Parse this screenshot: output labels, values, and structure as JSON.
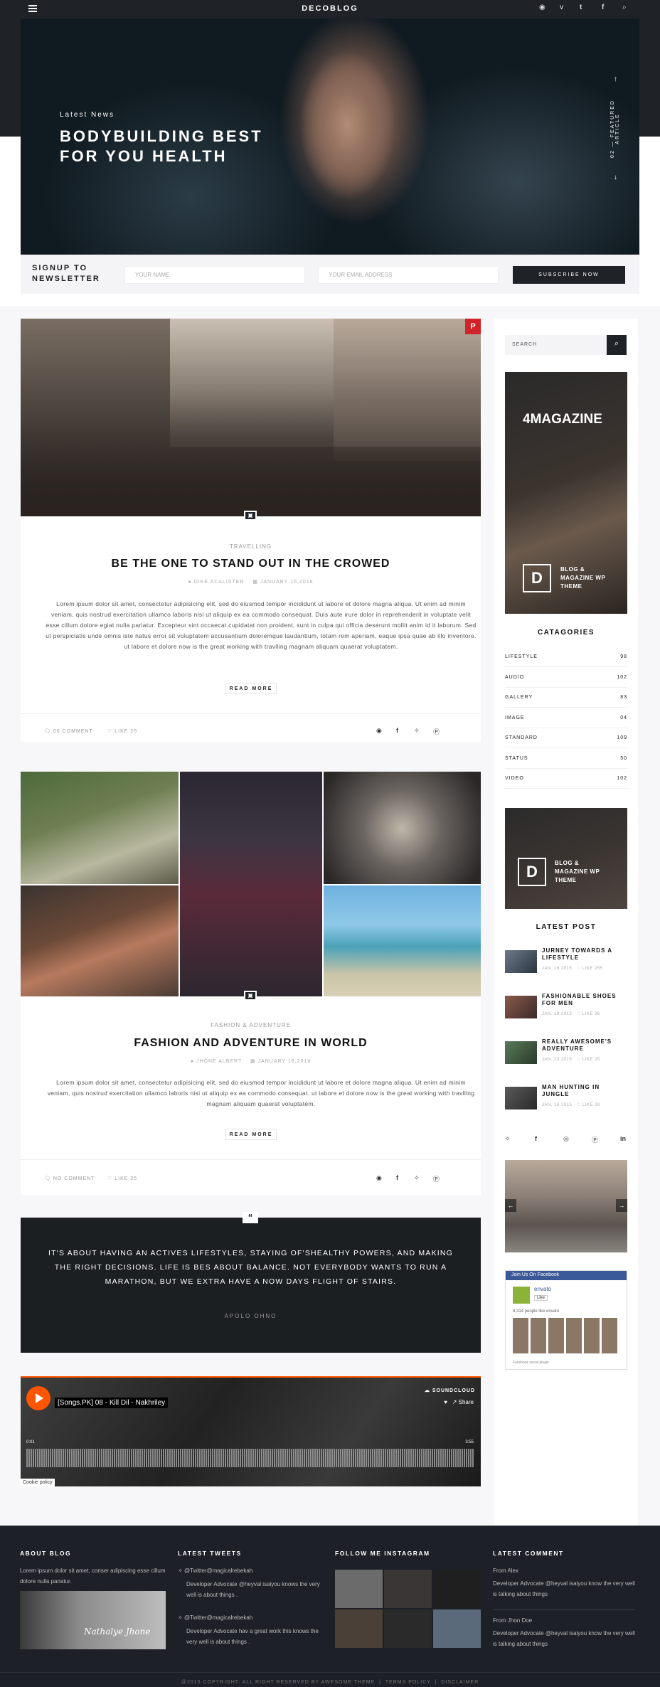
{
  "topbar": {
    "logo": "DECOBLOG",
    "social": [
      "rss-icon",
      "vimeo-icon",
      "tumblr-icon",
      "facebook-icon",
      "search-icon"
    ]
  },
  "hero": {
    "kicker": "Latest News",
    "title": "BODYBUILDING BEST FOR YOU HEALTH",
    "side_label": "FEATURED ARTICLE",
    "side_num": "02"
  },
  "newsletter": {
    "label": "SIGNUP TO NEWSLETTER",
    "name_placeholder": "YOUR NAME",
    "email_placeholder": "YOUR EMAIL ADDRESS",
    "button": "SUBSCRIBE NOW"
  },
  "posts": [
    {
      "category": "TRAVELLING",
      "title": "BE THE ONE TO STAND OUT IN THE CROWED",
      "author": "DIKE ACALISTER",
      "date": "JANUARY 16,2016",
      "excerpt": "Lorem ipsum dolor sit amet, consectetur adipisicing elit, sed do eiusmod tempor incididunt ut labore et dolore magna aliqua. Ut enim ad minim veniam, quis nostrud exercitation ullamco laboris nisi ut aliquip ex ea commodo consequat. Duis aute irure dolor in reprehenderit in voluptate velit esse cillum dolore egiat nulla pariatur. Excepteur sint occaecat cupidatat non proident, sunt in culpa qui officia deserunt mollit anim id it laborum. Sed ut perspiciatis unde omnis iste natus error sit voluptatem accusantium doloremque laudantium, totam rem aperiam, eaque ipsa quae ab illo inventore. ut labore et dolore now is the great working with travlling magnam aliquam quaerat voluptatem.",
      "read_more": "READ MORE",
      "comments": "06 COMMENT",
      "likes": "LIKE 25"
    },
    {
      "category": "FASHION & ADVENTURE",
      "title": "FASHION AND ADVENTURE IN WORLD",
      "author": "JHONE ALBERT",
      "date": "JANUARY 16,2016",
      "excerpt": "Lorem ipsum dolor sit amet, consectetur adipisicing elit, sed do eiusmod tempor incididunt ut labore et dolore magna aliqua. Ut enim ad minim veniam, quis nostrud exercitation ullamco laboris nisi ut aliquip ex ea commodo consequat. ut labore et dolore now is the great working with travlling magnam aliquam quaerat voluptatem.",
      "read_more": "READ MORE",
      "comments": "NO COMMENT",
      "likes": "LIKE 25"
    }
  ],
  "quote": {
    "text": "IT'S ABOUT HAVING AN ACTIVES LIFESTYLES, STAYING OF'SHEALTHY POWERS, AND MAKING THE RIGHT DECISIONS. LIFE IS BES ABOUT BALANCE. NOT EVERYBODY WANTS TO RUN A MARATHON, BUT WE EXTRA HAVE A NOW DAYS FLIGHT OF STAIRS.",
    "author": "APOLO OHNO"
  },
  "soundcloud": {
    "track": "[Songs.PK] 08 - Kill Dil - Nakhriley",
    "brand": "SOUNDCLOUD",
    "share": "Share",
    "cookie": "Cookie policy",
    "time_start": "0:01",
    "time_end": "3:55"
  },
  "sidebar": {
    "search_placeholder": "SEARCH",
    "ad1": {
      "title": "4MAGAZINE",
      "tagline": "BLOG & MAGAZINE WP THEME",
      "letter": "D"
    },
    "categories_title": "CATAGORIES",
    "categories": [
      {
        "name": "LIFESTYLE",
        "count": "98"
      },
      {
        "name": "AUDIO",
        "count": "102"
      },
      {
        "name": "GALLERY",
        "count": "83"
      },
      {
        "name": "IMAGE",
        "count": "04"
      },
      {
        "name": "STANDARD",
        "count": "109"
      },
      {
        "name": "STATUS",
        "count": "50"
      },
      {
        "name": "VIDEO",
        "count": "102"
      }
    ],
    "ad2": {
      "tagline": "BLOG & MAGAZINE WP THEME",
      "letter": "D"
    },
    "latest_title": "LATEST POST",
    "latest": [
      {
        "title": "JURNEY TOWARDS A LIFESTYLE",
        "date": "JAN. 16 2015",
        "likes": "LIKE 255"
      },
      {
        "title": "FASHIONABLE SHOES FOR MEN",
        "date": "JAN. 18 2015",
        "likes": "LIKE 26"
      },
      {
        "title": "REALLY AWESOME'S ADVENTURE",
        "date": "JAN. 23 2015",
        "likes": "LIKE 25"
      },
      {
        "title": "MAN HUNTING IN JUNGLE",
        "date": "JAN. 16 2015",
        "likes": "LIKE 28"
      }
    ],
    "facebook": {
      "header": "Join Us On Facebook",
      "page": "envato",
      "like": "Like",
      "count": "8,314 people like envato",
      "plugin": "Facebook social plugin"
    }
  },
  "footer": {
    "about_title": "ABOUT BLOG",
    "about_text": "Lorem ipsum dolor sit amet, conser adipiscing esse cillum dolore nulla pariatur.",
    "about_sig": "Nathalye Jhone",
    "tweets_title": "LATEST TWEETS",
    "tweets": [
      {
        "handle": "@Twitter@magicalrebekah",
        "text": "Developer Advocate @heyval isaiyou knows the very well is about things ."
      },
      {
        "handle": "@Twitter@magicalrebekah",
        "text": "Developer Advocate hav a great work this knows the very well is about things ."
      }
    ],
    "instagram_title": "FOLLOW ME INSTAGRAM",
    "comments_title": "LATEST COMMENT",
    "comments": [
      {
        "from": "From Alex",
        "text": "Developer Advocate @heyval isaiyou know the very well is talking about things"
      },
      {
        "from": "From Jhon Doe",
        "text": "Developer Advocate @heyval isaiyou know the very well is talking about things"
      }
    ],
    "copyright": "@2015 COPYRIGHT. ALL RIGHT RESERVED BY AWESOME THEME",
    "terms": "TERMS POLICY",
    "disclaimer": "DISCLAIMER"
  }
}
